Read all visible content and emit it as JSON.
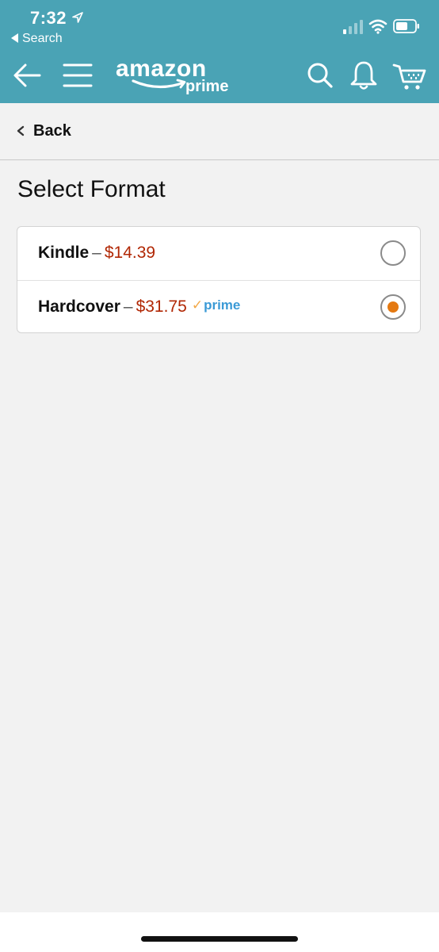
{
  "status_bar": {
    "time": "7:32",
    "back_app_label": "Search"
  },
  "header": {
    "logo_main": "amazon",
    "logo_sub": "prime",
    "icons": [
      "back-arrow-icon",
      "menu-icon",
      "search-icon",
      "bell-icon",
      "cart-icon"
    ]
  },
  "nav": {
    "back_label": "Back"
  },
  "page": {
    "title": "Select Format"
  },
  "formats": [
    {
      "name": "Kindle",
      "separator": "–",
      "price": "$14.39",
      "prime": "",
      "selected": false
    },
    {
      "name": "Hardcover",
      "separator": "–",
      "price": "$31.75",
      "prime": "prime",
      "prime_check": "✓",
      "selected": true
    }
  ],
  "colors": {
    "header_bg": "#4aa3b5",
    "price": "#b12704",
    "radio_selected": "#e47911",
    "prime_blue": "#3b9ad6",
    "prime_check": "#f3a847",
    "page_bg": "#f2f2f2"
  }
}
